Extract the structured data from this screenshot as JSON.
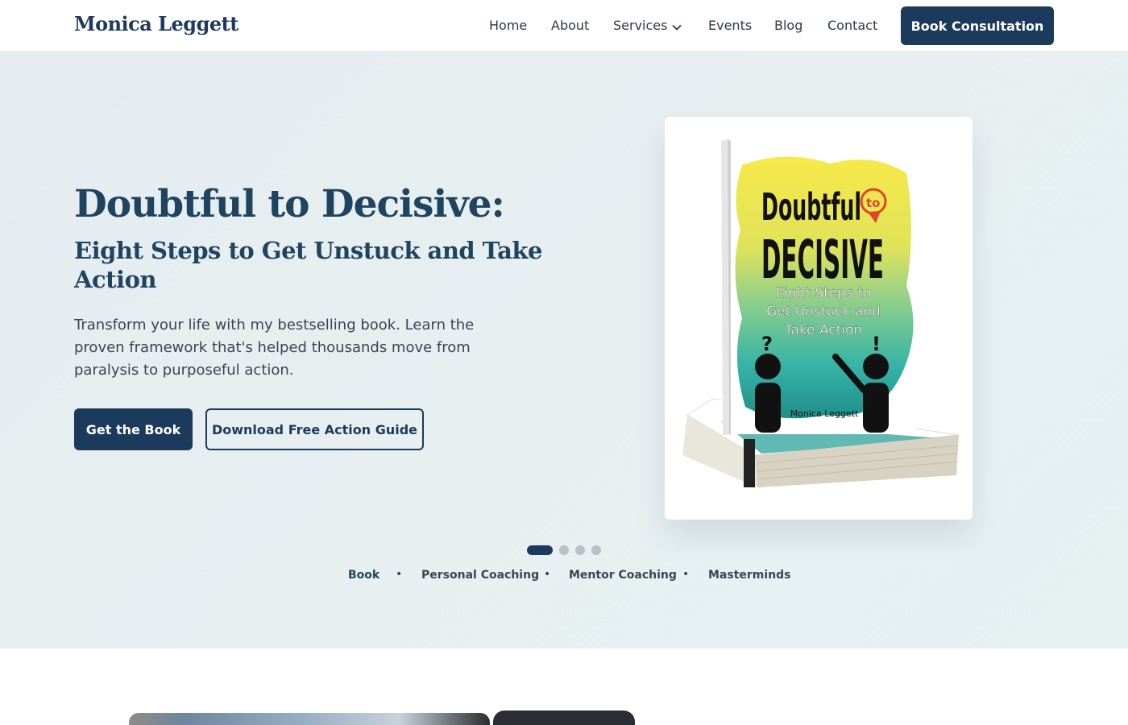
{
  "nav": {
    "logo": "Monica Leggett",
    "items": [
      "Home",
      "About",
      "Services",
      "Events",
      "Blog",
      "Contact"
    ],
    "cta": "Book Consultation"
  },
  "hero": {
    "title": "Doubtful to Decisive:",
    "subtitle": "Eight Steps to Get Unstuck and Take Action",
    "description": "Transform your life with my bestselling book. Learn the proven framework that's helped thousands move from paralysis to purposeful action.",
    "primary_button": "Get the Book",
    "secondary_button": "Download Free Action Guide"
  },
  "book_cover": {
    "title_line1": "Doubtful",
    "title_to": "to",
    "title_line2": "DECISIVE",
    "subtitle_lines": [
      "Eight Steps to",
      "Get Unstuck and",
      "Take Action"
    ],
    "author": "Monica Leggett"
  },
  "carousel": {
    "active_index": 0,
    "slide_count": 4,
    "tabs": [
      "Book",
      "Personal Coaching",
      "Mentor Coaching",
      "Masterminds"
    ]
  },
  "colors": {
    "primary": "#1b3a5c",
    "heading": "#1f4460",
    "hero_bg": "#e6eef0"
  }
}
